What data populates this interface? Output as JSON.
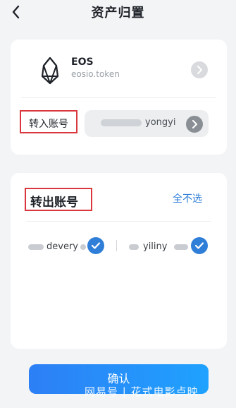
{
  "header": {
    "title": "资产归置",
    "back_icon": "chevron-left-icon"
  },
  "token": {
    "name": "EOS",
    "contract": "eosio.token",
    "icon": "eos-logo-icon"
  },
  "receive": {
    "label": "转入账号",
    "account_visible": "yongyi"
  },
  "transfer_out": {
    "title": "转出账号",
    "deselect_all": "全不选",
    "accounts": [
      {
        "visible_text": "devery",
        "checked": true
      },
      {
        "visible_text": "yiliny",
        "checked": true
      }
    ]
  },
  "footer": {
    "confirm_label": "确认"
  },
  "watermark": {
    "text": "网易号 | 花式电影点映"
  },
  "colors": {
    "accent": "#2f7ed8",
    "highlight_border": "#d9363e"
  }
}
